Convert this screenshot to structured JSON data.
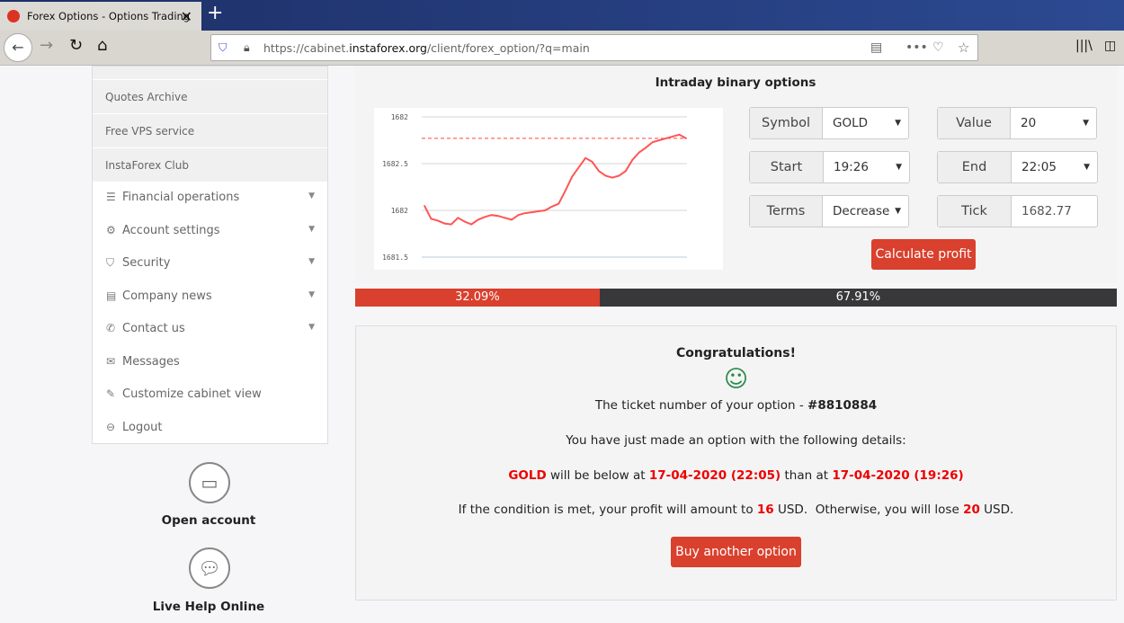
{
  "browser": {
    "tab_title": "Forex Options - Options Trading",
    "url_prefix": "https://cabinet.",
    "url_domain": "instaforex.org",
    "url_path": "/client/forex_option/?q=main"
  },
  "sidebar": {
    "grey_items": [
      {
        "label": "Quotes Archive"
      },
      {
        "label": "Free VPS service"
      },
      {
        "label": "InstaForex Club"
      }
    ],
    "items": [
      {
        "label": "Financial operations",
        "icon": "list-icon",
        "glyph": "☰",
        "dropdown": true
      },
      {
        "label": "Account settings",
        "icon": "gear-icon",
        "glyph": "⚙",
        "dropdown": true
      },
      {
        "label": "Security",
        "icon": "shield-icon",
        "glyph": "⛉",
        "dropdown": true
      },
      {
        "label": "Company news",
        "icon": "newspaper-icon",
        "glyph": "▤",
        "dropdown": true
      },
      {
        "label": "Contact us",
        "icon": "phone-icon",
        "glyph": "✆",
        "dropdown": true
      },
      {
        "label": "Messages",
        "icon": "envelope-icon",
        "glyph": "✉",
        "dropdown": false
      },
      {
        "label": "Customize cabinet view",
        "icon": "edit-icon",
        "glyph": "✎",
        "dropdown": false
      },
      {
        "label": "Logout",
        "icon": "logout-icon",
        "glyph": "⊖",
        "dropdown": false
      }
    ],
    "open_account": "Open account",
    "live_help": "Live Help Online"
  },
  "main": {
    "title": "Intraday binary options",
    "form": {
      "symbol_label": "Symbol",
      "symbol": "GOLD",
      "value_label": "Value",
      "value": "20",
      "start_label": "Start",
      "start": "19:26",
      "end_label": "End",
      "end": "22:05",
      "terms_label": "Terms",
      "terms": "Decrease",
      "tick_label": "Tick",
      "tick": "1682.77",
      "calculate": "Calculate profit"
    },
    "progress": {
      "decrease_pct": 32.09,
      "increase_pct": 67.91,
      "decrease_label": "32.09%",
      "increase_label": "67.91%",
      "colors": {
        "decrease": "#d9402d",
        "increase": "#38383a"
      }
    }
  },
  "result": {
    "heading": "Congratulations!",
    "ticket_text": "The ticket number of your option - ",
    "ticket": "#8810884",
    "details_intro": "You have just made an option with the following details:",
    "symbol": "GOLD",
    "mid1": " will be below at ",
    "date_end": "17-04-2020 (22:05)",
    "mid2": " than at ",
    "date_start": "17-04-2020 (19:26)",
    "profit_pre": "If the condition is met, your profit will amount to ",
    "profit": "16",
    "profit_post": " USD.  Otherwise, you will lose ",
    "loss": "20",
    "loss_post": " USD.",
    "buy_again": "Buy another option"
  },
  "chart_data": {
    "type": "line",
    "ylim": [
      1681.5,
      1683
    ],
    "y_ticks": [
      1683,
      1682.5,
      1682,
      1681.5
    ],
    "y_tick_labels": [
      "1682",
      "1682.5",
      "1682",
      "1681.5"
    ],
    "grid": true,
    "reference_line": 1682.77,
    "line_color": "#ff5555",
    "values": [
      1682.05,
      1681.91,
      1681.89,
      1681.86,
      1681.85,
      1681.92,
      1681.88,
      1681.85,
      1681.9,
      1681.93,
      1681.95,
      1681.94,
      1681.92,
      1681.9,
      1681.95,
      1681.97,
      1681.98,
      1681.99,
      1682.0,
      1682.04,
      1682.07,
      1682.21,
      1682.36,
      1682.46,
      1682.56,
      1682.52,
      1682.42,
      1682.37,
      1682.35,
      1682.37,
      1682.42,
      1682.54,
      1682.62,
      1682.67,
      1682.73,
      1682.75,
      1682.77,
      1682.79,
      1682.81,
      1682.77
    ]
  }
}
